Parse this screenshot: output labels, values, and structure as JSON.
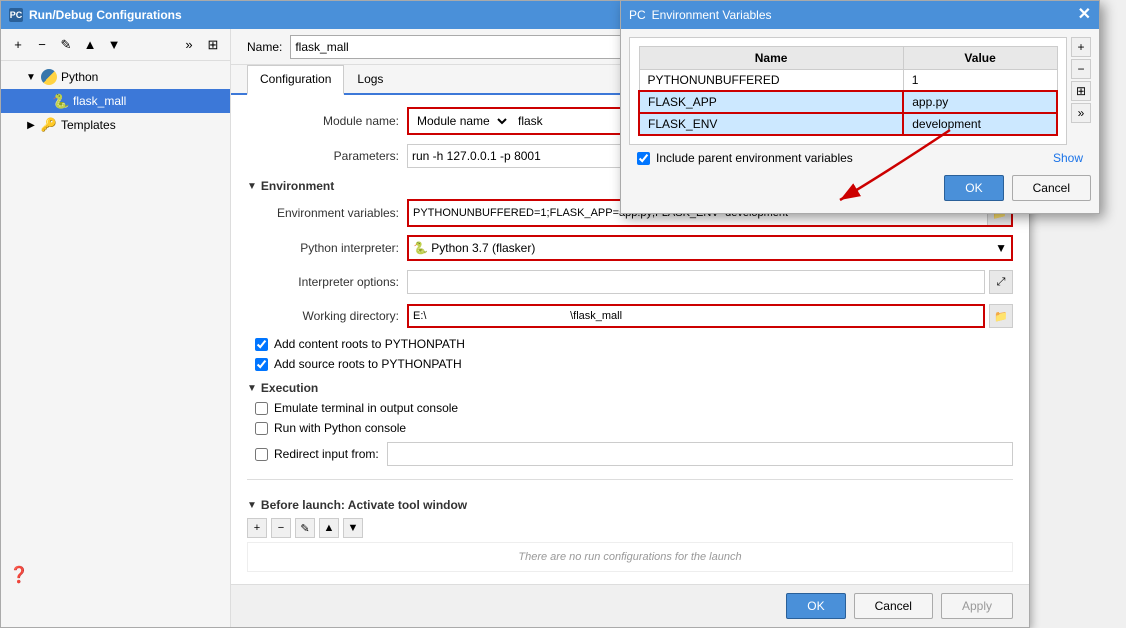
{
  "mainDialog": {
    "title": "Run/Debug Configurations",
    "titleIcon": "PC"
  },
  "leftPanel": {
    "toolbarButtons": [
      "+",
      "−",
      "✎",
      "▲",
      "▼",
      "⊞"
    ],
    "tree": {
      "python": {
        "label": "Python",
        "expanded": true,
        "children": [
          {
            "label": "flask_mall",
            "selected": true
          },
          {
            "label": "Templates",
            "expanded": false
          }
        ]
      }
    }
  },
  "nameField": {
    "label": "Name:",
    "value": "flask_mall"
  },
  "tabs": [
    "Configuration",
    "Logs"
  ],
  "activeTab": "Configuration",
  "configForm": {
    "moduleNameLabel": "Module name:",
    "moduleNameValue": "flask",
    "parametersLabel": "Parameters:",
    "parametersValue": "run -h 127.0.0.1 -p 8001",
    "environmentSection": "Environment",
    "envVarsLabel": "Environment variables:",
    "envVarsValue": "PYTHONUNBUFFERED=1;FLASK_APP=app.py;FLASK_ENV=development",
    "pythonInterpreterLabel": "Python interpreter:",
    "pythonInterpreterValue": "🐍 Python 3.7 (flasker)",
    "interpreterOptionsLabel": "Interpreter options:",
    "interpreterOptionsValue": "",
    "workingDirLabel": "Working directory:",
    "workingDirValue": "E:\\                                               \\flask_mall",
    "addContentRoots": "Add content roots to PYTHONPATH",
    "addSourceRoots": "Add source roots to PYTHONPATH",
    "executionSection": "Execution",
    "emulateTerminal": "Emulate terminal in output console",
    "runWithPython": "Run with Python console",
    "redirectInput": "Redirect input from:",
    "redirectInputValue": "",
    "beforeLaunch": "Before launch: Activate tool window",
    "tipText": "There are no run configurations for the launch"
  },
  "footer": {
    "okLabel": "OK",
    "cancelLabel": "Cancel",
    "applyLabel": "Apply"
  },
  "envDialog": {
    "title": "Environment Variables",
    "titleIcon": "PC",
    "columns": [
      "Name",
      "Value"
    ],
    "rows": [
      {
        "name": "PYTHONUNBUFFERED",
        "value": "1",
        "highlighted": false
      },
      {
        "name": "FLASK_APP",
        "value": "app.py",
        "highlighted": true
      },
      {
        "name": "FLASK_ENV",
        "value": "development",
        "highlighted": true
      }
    ],
    "includeParentLabel": "Include parent environment variables",
    "showLabel": "Show",
    "okLabel": "OK",
    "cancelLabel": "Cancel"
  }
}
